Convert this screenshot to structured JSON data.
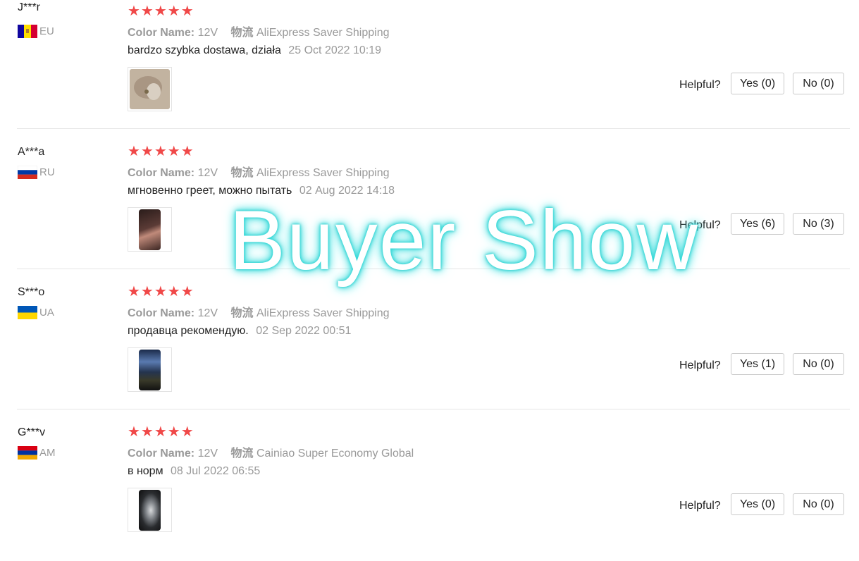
{
  "labels": {
    "color_name": "Color Name:",
    "shipping_prefix": "物流",
    "helpful": "Helpful?"
  },
  "watermark": "Buyer Show",
  "colors": {
    "star": "#f04848",
    "muted_text": "#999999",
    "watermark_glow": "#2fd6d6"
  },
  "reviews": [
    {
      "user": "J***r",
      "country": "EU",
      "flag": "andorra",
      "rating": "★★★★★",
      "color_value": "12V",
      "shipping": "AliExpress Saver Shipping",
      "text": "bardzo szybka dostawa, działa",
      "date": "25 Oct 2022 10:19",
      "yes": "Yes (0)",
      "no": "No (0)"
    },
    {
      "user": "A***a",
      "country": "RU",
      "flag": "russia",
      "rating": "★★★★★",
      "color_value": "12V",
      "shipping": "AliExpress Saver Shipping",
      "text": "мгновенно греет, можно пытать",
      "date": "02 Aug 2022 14:18",
      "yes": "Yes (6)",
      "no": "No (3)"
    },
    {
      "user": "S***o",
      "country": "UA",
      "flag": "ukraine",
      "rating": "★★★★★",
      "color_value": "12V",
      "shipping": "AliExpress Saver Shipping",
      "text": "продавца рекомендую.",
      "date": "02 Sep 2022 00:51",
      "yes": "Yes (1)",
      "no": "No (0)"
    },
    {
      "user": "G***v",
      "country": "AM",
      "flag": "armenia",
      "rating": "★★★★★",
      "color_value": "12V",
      "shipping": "Cainiao Super Economy Global",
      "text": "в норм",
      "date": "08 Jul 2022 06:55",
      "yes": "Yes (0)",
      "no": "No (0)"
    }
  ]
}
